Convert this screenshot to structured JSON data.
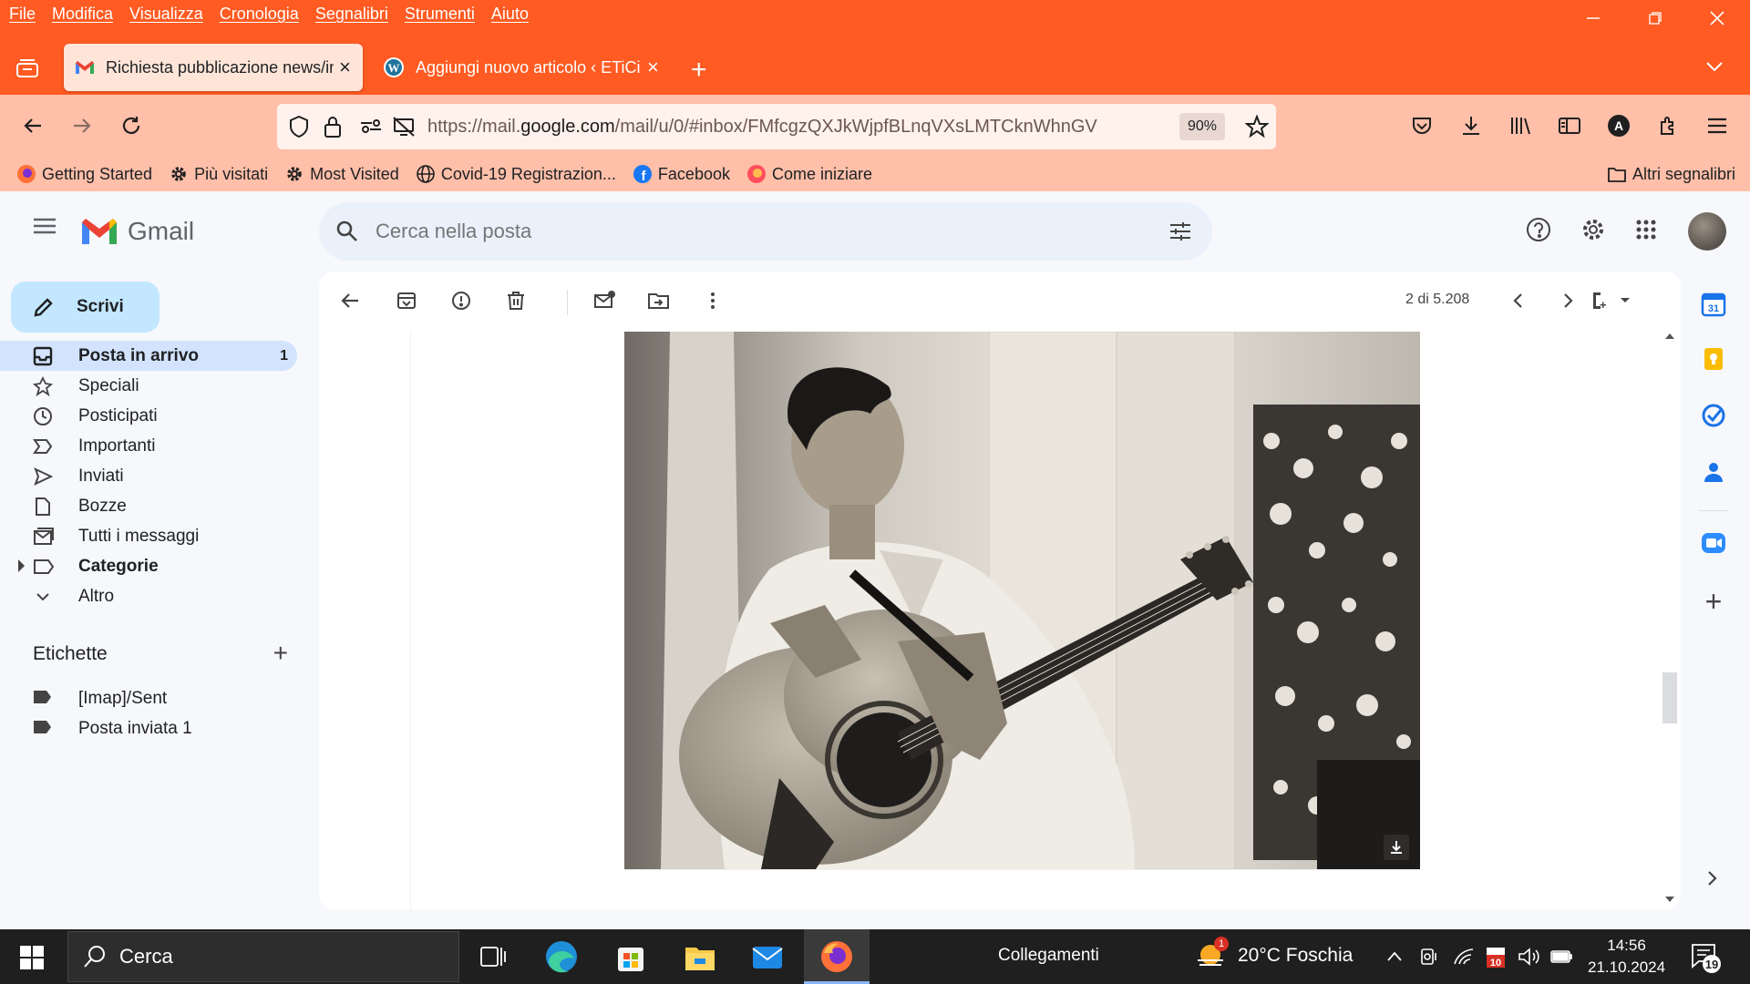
{
  "browser": {
    "menu": [
      "File",
      "Modifica",
      "Visualizza",
      "Cronologia",
      "Segnalibri",
      "Strumenti",
      "Aiuto"
    ],
    "tabs": [
      {
        "title": "Richiesta pubblicazione news/in",
        "icon": "gmail-icon"
      },
      {
        "title": "Aggiungi nuovo articolo ‹ ETiCi",
        "icon": "wordpress-icon"
      }
    ],
    "url_prefix": "https://mail.",
    "url_domain": "google.com",
    "url_path": "/mail/u/0/#inbox/FMfcgzQXJkWjpfBLnqVXsLMTCknWhnGV",
    "zoom": "90%",
    "bookmarks": [
      {
        "label": "Getting Started",
        "icon": "firefox-icon"
      },
      {
        "label": "Più visitati",
        "icon": "gear-icon"
      },
      {
        "label": "Most Visited",
        "icon": "gear-icon"
      },
      {
        "label": "Covid-19 Registrazion...",
        "icon": "globe-icon"
      },
      {
        "label": "Facebook",
        "icon": "facebook-icon"
      },
      {
        "label": "Come iniziare",
        "icon": "firefox-icon"
      }
    ],
    "other_bookmarks": "Altri segnalibri",
    "avatar_letter": "A",
    "accent": "#ff5b22"
  },
  "gmail": {
    "brand": "Gmail",
    "search_placeholder": "Cerca nella posta",
    "compose": "Scrivi",
    "nav": [
      {
        "label": "Posta in arrivo",
        "count": "1",
        "active": true
      },
      {
        "label": "Speciali"
      },
      {
        "label": "Posticipati"
      },
      {
        "label": "Importanti"
      },
      {
        "label": "Inviati"
      },
      {
        "label": "Bozze"
      },
      {
        "label": "Tutti i messaggi"
      },
      {
        "label": "Categorie"
      },
      {
        "label": "Altro"
      }
    ],
    "labels_title": "Etichette",
    "labels": [
      "[Imap]/Sent",
      "Posta inviata 1"
    ],
    "pager": "2 di 5.208"
  },
  "taskbar": {
    "search": "Cerca",
    "links": "Collegamenti",
    "weather": "20°C  Foschia",
    "weather_badge": "1",
    "time": "14:56",
    "date": "21.10.2024",
    "notif_count": "19",
    "calendar_badge": "10"
  }
}
